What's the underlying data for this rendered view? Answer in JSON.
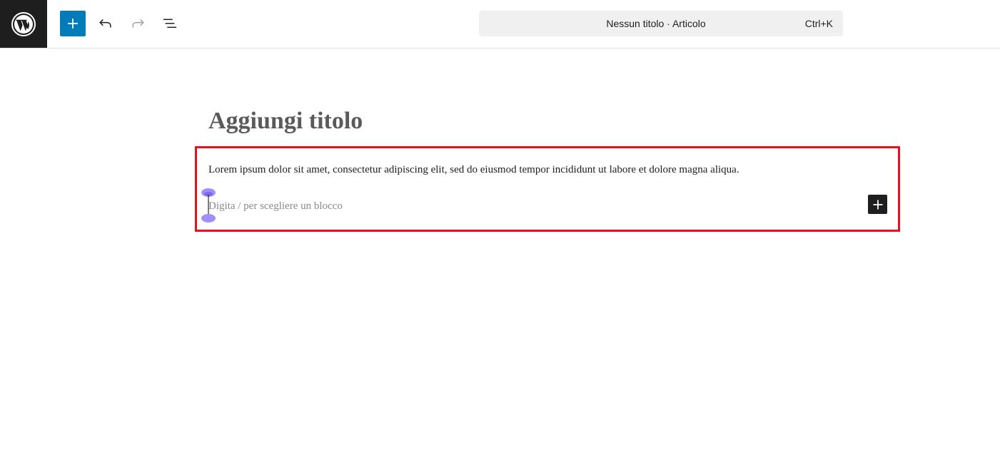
{
  "toolbar": {
    "logo_icon": "wordpress-logo",
    "inserter_icon": "plus-icon",
    "undo_icon": "undo-icon",
    "redo_icon": "redo-icon",
    "list_view_icon": "list-view-icon",
    "command_bar": {
      "title": "Nessun titolo · Articolo",
      "shortcut": "Ctrl+K"
    }
  },
  "editor": {
    "title_placeholder": "Aggiungi titolo",
    "paragraph_text": "Lorem ipsum dolor sit amet, consectetur adipiscing elit, sed do eiusmod tempor incididunt ut labore et dolore magna aliqua.",
    "block_placeholder": "Digita / per scegliere un blocco",
    "block_add_icon": "plus-icon"
  },
  "colors": {
    "accent": "#007cba",
    "dark": "#1e1e1e",
    "highlight": "#e8101a",
    "caret_handle": "#8f7cff"
  }
}
